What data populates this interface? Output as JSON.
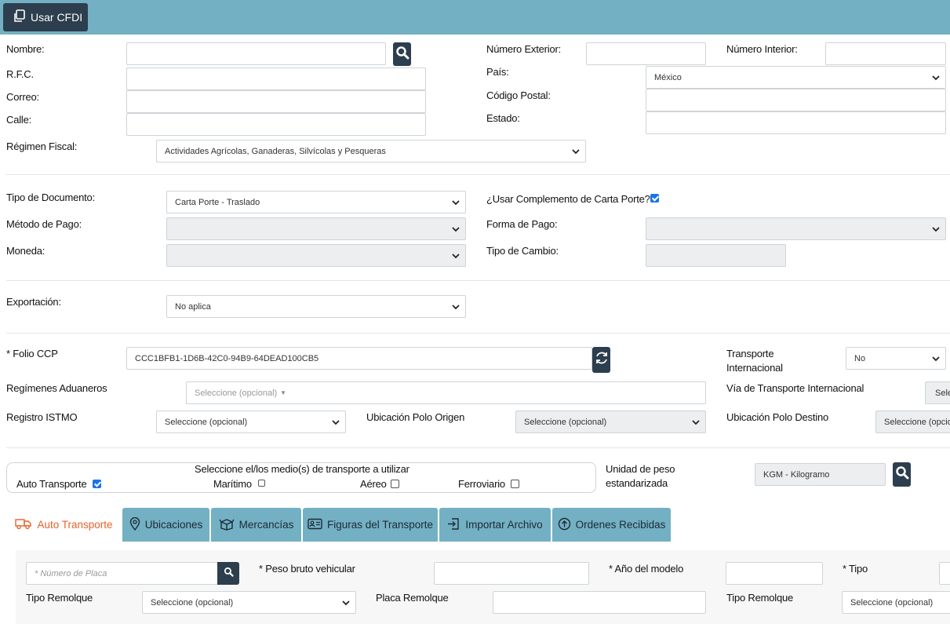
{
  "toolbar": {
    "usar_cfdi": "Usar CFDI"
  },
  "cliente": {
    "nombre_label": "Nombre:",
    "rfc_label": "R.F.C.",
    "correo_label": "Correo:",
    "calle_label": "Calle:",
    "regimen_label": "Régimen Fiscal:",
    "regimen_value": "Actividades Agrícolas, Ganaderas, Silvícolas y Pesqueras",
    "num_ext_label": "Número Exterior:",
    "num_int_label": "Número Interior:",
    "pais_label": "País:",
    "pais_value": "México",
    "cp_label": "Código Postal:",
    "estado_label": "Estado:"
  },
  "documento": {
    "tipo_doc_label": "Tipo de Documento:",
    "tipo_doc_value": "Carta Porte - Traslado",
    "complemento_label": "¿Usar Complemento de Carta Porte?",
    "complemento_checked": true,
    "metodo_pago_label": "Método de Pago:",
    "forma_pago_label": "Forma de Pago:",
    "moneda_label": "Moneda:",
    "tipo_cambio_label": "Tipo de Cambio:",
    "exportacion_label": "Exportación:",
    "exportacion_value": "No aplica"
  },
  "carta_porte": {
    "folio_label": "* Folio CCP",
    "folio_value": "CCC1BFB1-1D6B-42C0-94B9-64DEAD100CB5",
    "transporte_int_label_1": "Transporte",
    "transporte_int_label_2": "Internacional",
    "transporte_int_value": "No",
    "regimenes_label": "Regímenes Aduaneros",
    "regimenes_placeholder": "Seleccione (opcional)",
    "via_label": "Vía de Transporte Internacional",
    "via_value": "Sele",
    "istmo_label": "Registro ISTMO",
    "istmo_value": "Seleccione (opcional)",
    "polo_origen_label": "Ubicación Polo Origen",
    "polo_origen_value": "Seleccione (opcional)",
    "polo_destino_label": "Ubicación Polo Destino",
    "polo_destino_value": "Seleccione (opcio"
  },
  "transportes": {
    "title": "Seleccione el/los medio(s) de transporte a utilizar",
    "auto": "Auto Transporte",
    "auto_checked": true,
    "maritimo": "Marítimo",
    "aereo": "Aéreo",
    "ferroviario": "Ferroviario",
    "unidad_label_1": "Unidad de peso",
    "unidad_label_2": "estandarizada",
    "unidad_value": "KGM - Kilogramo"
  },
  "tabs": [
    {
      "label": "Auto Transporte",
      "icon": "truck-icon"
    },
    {
      "label": "Ubicaciones",
      "icon": "map-pin-icon"
    },
    {
      "label": "Mercancías",
      "icon": "boxes-icon"
    },
    {
      "label": "Figuras del Transporte",
      "icon": "id-card-icon"
    },
    {
      "label": "Importar Archivo",
      "icon": "import-icon"
    },
    {
      "label": "Ordenes Recibidas",
      "icon": "upload-circle-icon"
    }
  ],
  "auto_panel": {
    "placa_placeholder": "* Número de Placa",
    "peso_bruto_label": "* Peso bruto vehicular",
    "anio_label": "* Año del modelo",
    "tipo_label": "* Tipo",
    "tipo_remolque_label": "Tipo Remolque",
    "tipo_remolque_value": "Seleccione (opcional)",
    "placa_remolque_label": "Placa Remolque",
    "tipo_remolque2_label": "Tipo Remolque",
    "tipo_remolque2_value": "Seleccione (opcional)"
  },
  "colors": {
    "header": "#73b0c3",
    "dark": "#2d3e4e",
    "active_tab": "#e8622a"
  }
}
